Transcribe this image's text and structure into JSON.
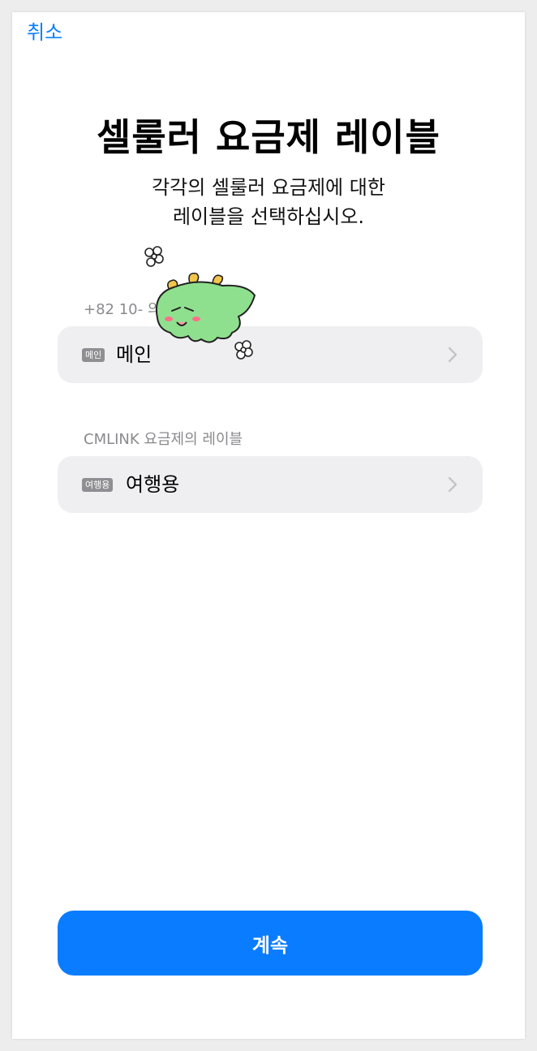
{
  "header": {
    "cancel_label": "취소"
  },
  "title": "셀룰러 요금제 레이블",
  "subtitle": [
    "각각의 셀룰러 요금제에 대한",
    "레이블을 선택하십시오."
  ],
  "plans": [
    {
      "section_label": "+82 10-     의 레이블",
      "badge": "메인",
      "label": "메인"
    },
    {
      "section_label": "CMLINK 요금제의 레이블",
      "badge": "여행용",
      "label": "여행용"
    }
  ],
  "continue_label": "계속",
  "colors": {
    "accent": "#0a7cff",
    "row_bg": "#efeff1",
    "secondary_text": "#8a8a8e"
  },
  "sticker": {
    "icon": "green-dragon-sticker-icon"
  }
}
